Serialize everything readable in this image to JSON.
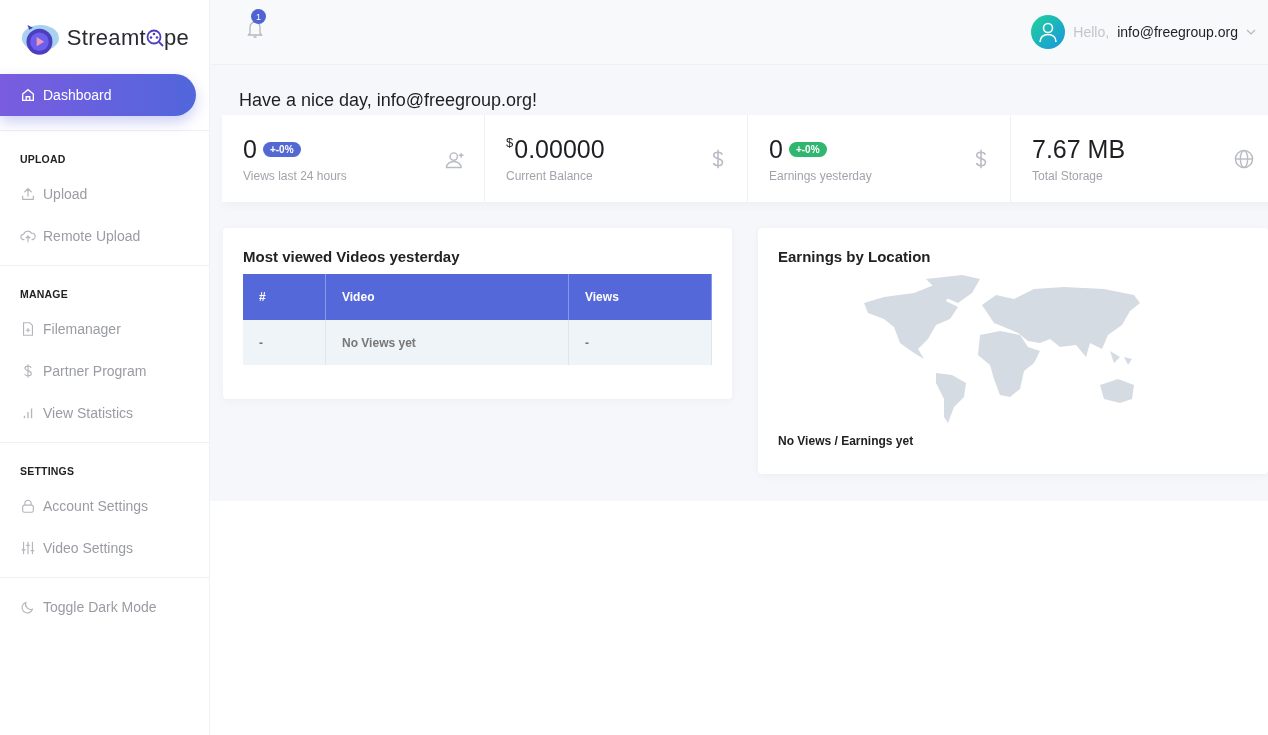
{
  "logo": {
    "text_before": "Streamt",
    "text_after": "pe"
  },
  "sidebar": {
    "sections": [
      {
        "items": [
          {
            "label": "Dashboard",
            "selected": true
          }
        ]
      },
      {
        "heading": "UPLOAD",
        "items": [
          {
            "label": "Upload",
            "selected": false
          },
          {
            "label": "Remote Upload",
            "selected": false
          }
        ]
      },
      {
        "heading": "MANAGE",
        "items": [
          {
            "label": "Filemanager",
            "selected": false
          },
          {
            "label": "Partner Program",
            "selected": false
          },
          {
            "label": "View Statistics",
            "selected": false
          }
        ]
      },
      {
        "heading": "SETTINGS",
        "items": [
          {
            "label": "Account Settings",
            "selected": false
          },
          {
            "label": "Video Settings",
            "selected": false
          }
        ]
      },
      {
        "items": [
          {
            "label": "Toggle Dark Mode",
            "selected": false
          }
        ]
      }
    ]
  },
  "header": {
    "notification_count": "1",
    "greeting": "Hello,",
    "user": "info@freegroup.org"
  },
  "greeting": "Have a nice day, info@freegroup.org!",
  "stats": [
    {
      "value": "0",
      "badge": {
        "text": "+-0%",
        "color": "#5468d4"
      },
      "label": "Views last 24 hours"
    },
    {
      "currency": "$",
      "value": "0.00000",
      "label": "Current Balance"
    },
    {
      "value": "0",
      "badge": {
        "text": "+-0%",
        "color": "#2fb66f"
      },
      "label": "Earnings yesterday"
    },
    {
      "value": "7.67 MB",
      "label": "Total Storage"
    }
  ],
  "videos_panel": {
    "title": "Most viewed Videos yesterday",
    "columns": [
      "#",
      "Video",
      "Views"
    ],
    "rows": [
      [
        "-",
        "No Views yet",
        "-"
      ]
    ]
  },
  "map_panel": {
    "title": "Earnings by Location",
    "note": "No Views / Earnings yet"
  }
}
